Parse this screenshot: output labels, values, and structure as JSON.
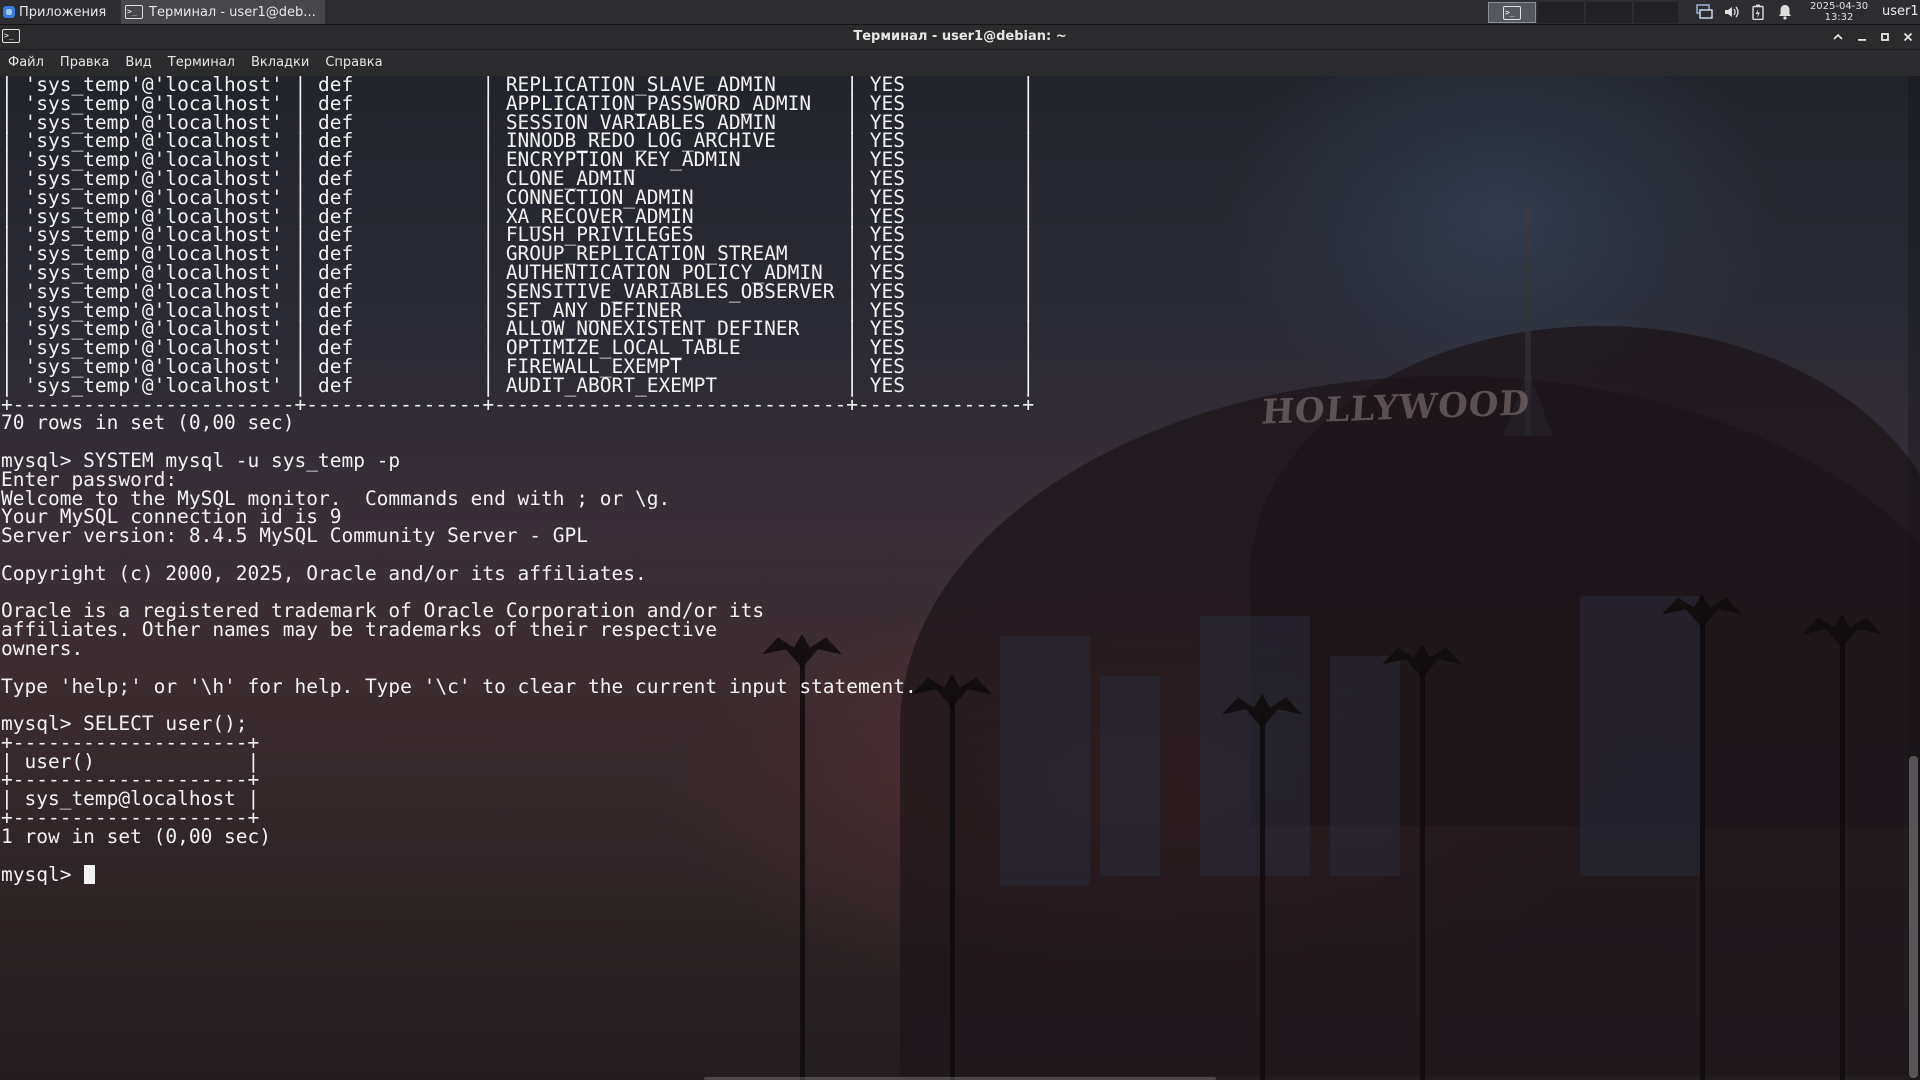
{
  "panel": {
    "apps_label": "Приложения",
    "task_title": "Терминал - user1@deb...",
    "clock_date": "2025-04-30",
    "clock_time": "13:32",
    "user": "user1"
  },
  "window": {
    "title": "Терминал - user1@debian: ~",
    "menu": [
      "Файл",
      "Правка",
      "Вид",
      "Терминал",
      "Вкладки",
      "Справка"
    ]
  },
  "wallpaper": {
    "sign_text": "HOLLYWOOD"
  },
  "terminal": {
    "lines": [
      "| 'sys_temp'@'localhost' | def           | REPLICATION_SLAVE_ADMIN      | YES          |",
      "| 'sys_temp'@'localhost' | def           | APPLICATION_PASSWORD_ADMIN   | YES          |",
      "| 'sys_temp'@'localhost' | def           | SESSION_VARIABLES_ADMIN      | YES          |",
      "| 'sys_temp'@'localhost' | def           | INNODB_REDO_LOG_ARCHIVE      | YES          |",
      "| 'sys_temp'@'localhost' | def           | ENCRYPTION_KEY_ADMIN         | YES          |",
      "| 'sys_temp'@'localhost' | def           | CLONE_ADMIN                  | YES          |",
      "| 'sys_temp'@'localhost' | def           | CONNECTION_ADMIN             | YES          |",
      "| 'sys_temp'@'localhost' | def           | XA_RECOVER_ADMIN             | YES          |",
      "| 'sys_temp'@'localhost' | def           | FLUSH_PRIVILEGES             | YES          |",
      "| 'sys_temp'@'localhost' | def           | GROUP_REPLICATION_STREAM     | YES          |",
      "| 'sys_temp'@'localhost' | def           | AUTHENTICATION_POLICY_ADMIN  | YES          |",
      "| 'sys_temp'@'localhost' | def           | SENSITIVE_VARIABLES_OBSERVER | YES          |",
      "| 'sys_temp'@'localhost' | def           | SET_ANY_DEFINER              | YES          |",
      "| 'sys_temp'@'localhost' | def           | ALLOW_NONEXISTENT_DEFINER    | YES          |",
      "| 'sys_temp'@'localhost' | def           | OPTIMIZE_LOCAL_TABLE         | YES          |",
      "| 'sys_temp'@'localhost' | def           | FIREWALL_EXEMPT              | YES          |",
      "| 'sys_temp'@'localhost' | def           | AUDIT_ABORT_EXEMPT           | YES          |",
      "+------------------------+---------------+------------------------------+--------------+",
      "70 rows in set (0,00 sec)",
      "",
      "mysql> SYSTEM mysql -u sys_temp -p",
      "Enter password:",
      "Welcome to the MySQL monitor.  Commands end with ; or \\g.",
      "Your MySQL connection id is 9",
      "Server version: 8.4.5 MySQL Community Server - GPL",
      "",
      "Copyright (c) 2000, 2025, Oracle and/or its affiliates.",
      "",
      "Oracle is a registered trademark of Oracle Corporation and/or its",
      "affiliates. Other names may be trademarks of their respective",
      "owners.",
      "",
      "Type 'help;' or '\\h' for help. Type '\\c' to clear the current input statement.",
      "",
      "mysql> SELECT user();",
      "+--------------------+",
      "| user()             |",
      "+--------------------+",
      "| sys_temp@localhost |",
      "+--------------------+",
      "1 row in set (0,00 sec)",
      ""
    ],
    "prompt": "mysql> "
  }
}
